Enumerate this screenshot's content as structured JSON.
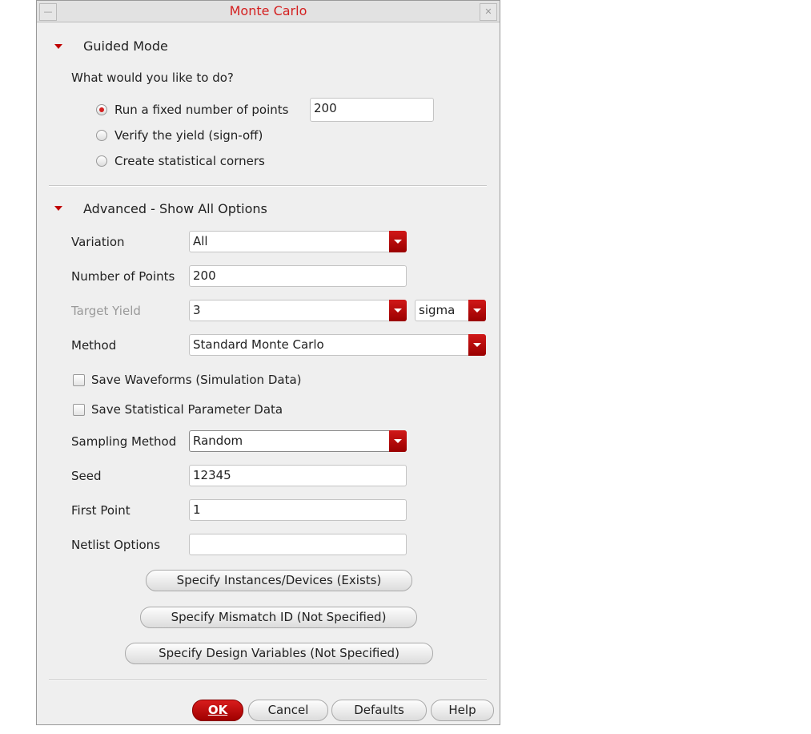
{
  "window": {
    "title": "Monte Carlo"
  },
  "guided": {
    "header": "Guided Mode",
    "question": "What would you like to do?",
    "options": [
      {
        "label": "Run a fixed number of points",
        "selected": true
      },
      {
        "label": "Verify the yield (sign-off)",
        "selected": false
      },
      {
        "label": "Create statistical corners",
        "selected": false
      }
    ],
    "points_value": "200"
  },
  "advanced": {
    "header": "Advanced - Show All Options",
    "variation": {
      "label": "Variation",
      "value": "All"
    },
    "num_points": {
      "label": "Number of Points",
      "value": "200"
    },
    "target_yield": {
      "label": "Target Yield",
      "value": "3",
      "unit": "sigma"
    },
    "method": {
      "label": "Method",
      "value": "Standard Monte Carlo"
    },
    "save_waveforms": {
      "label": "Save Waveforms (Simulation Data)",
      "checked": false
    },
    "save_stat": {
      "label": "Save Statistical Parameter Data",
      "checked": false
    },
    "sampling": {
      "label": "Sampling Method",
      "value": "Random"
    },
    "seed": {
      "label": "Seed",
      "value": "12345"
    },
    "first_point": {
      "label": "First Point",
      "value": "1"
    },
    "netlist": {
      "label": "Netlist Options",
      "value": ""
    },
    "buttons": {
      "instances": "Specify Instances/Devices (Exists)",
      "mismatch": "Specify Mismatch ID (Not Specified)",
      "design_vars": "Specify Design Variables (Not Specified)"
    }
  },
  "footer": {
    "ok": "OK",
    "cancel": "Cancel",
    "defaults": "Defaults",
    "help": "Help"
  }
}
